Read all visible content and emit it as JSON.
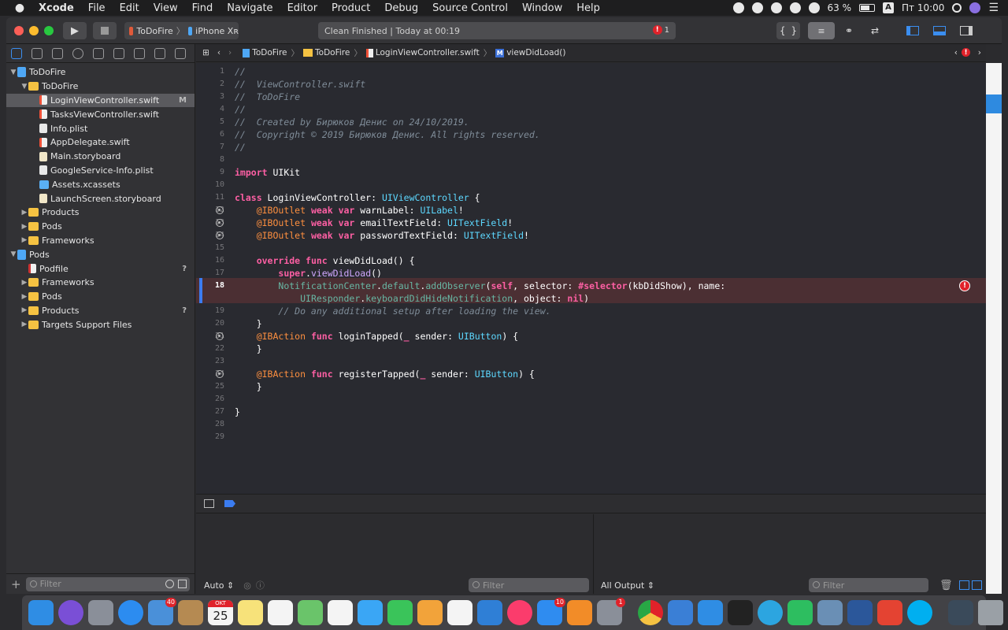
{
  "menubar": {
    "app_name": "Xcode",
    "menus": [
      "File",
      "Edit",
      "View",
      "Find",
      "Navigate",
      "Editor",
      "Product",
      "Debug",
      "Source Control",
      "Window",
      "Help"
    ],
    "battery": "63 %",
    "input_source": "A",
    "clock": "Пт 10:00"
  },
  "toolbar": {
    "scheme_name": "ToDoFire",
    "device_name": "iPhone Xʀ",
    "status_text": "Clean Finished | Today at 00:19",
    "error_count": "1"
  },
  "navigator": {
    "items": [
      {
        "label": "ToDoFire",
        "indent": 0,
        "icon": "project",
        "disclosure": "open"
      },
      {
        "label": "ToDoFire",
        "indent": 1,
        "icon": "folder",
        "disclosure": "open"
      },
      {
        "label": "LoginViewController.swift",
        "indent": 2,
        "icon": "swift",
        "selected": true,
        "badge": "M"
      },
      {
        "label": "TasksViewController.swift",
        "indent": 2,
        "icon": "swift"
      },
      {
        "label": "Info.plist",
        "indent": 2,
        "icon": "plist"
      },
      {
        "label": "AppDelegate.swift",
        "indent": 2,
        "icon": "swift"
      },
      {
        "label": "Main.storyboard",
        "indent": 2,
        "icon": "storyboard"
      },
      {
        "label": "GoogleService-Info.plist",
        "indent": 2,
        "icon": "plist"
      },
      {
        "label": "Assets.xcassets",
        "indent": 2,
        "icon": "assets"
      },
      {
        "label": "LaunchScreen.storyboard",
        "indent": 2,
        "icon": "storyboard"
      },
      {
        "label": "Products",
        "indent": 1,
        "icon": "folder",
        "disclosure": "closed"
      },
      {
        "label": "Pods",
        "indent": 1,
        "icon": "folder",
        "disclosure": "closed"
      },
      {
        "label": "Frameworks",
        "indent": 1,
        "icon": "folder",
        "disclosure": "closed"
      },
      {
        "label": "Pods",
        "indent": 0,
        "icon": "project",
        "disclosure": "open"
      },
      {
        "label": "Podfile",
        "indent": 1,
        "icon": "podfile",
        "badge": "?"
      },
      {
        "label": "Frameworks",
        "indent": 1,
        "icon": "folder",
        "disclosure": "closed"
      },
      {
        "label": "Pods",
        "indent": 1,
        "icon": "folder",
        "disclosure": "closed"
      },
      {
        "label": "Products",
        "indent": 1,
        "icon": "folder",
        "disclosure": "closed",
        "badge": "?"
      },
      {
        "label": "Targets Support Files",
        "indent": 1,
        "icon": "folder",
        "disclosure": "closed"
      }
    ],
    "filter_placeholder": "Filter"
  },
  "jumpbar": {
    "crumbs": [
      "ToDoFire",
      "ToDoFire",
      "LoginViewController.swift",
      "viewDidLoad()"
    ]
  },
  "editor": {
    "current_line": 18,
    "lines": [
      {
        "n": "1",
        "tokens": [
          [
            "cm",
            "//"
          ]
        ]
      },
      {
        "n": "2",
        "tokens": [
          [
            "cm",
            "//  ViewController.swift"
          ]
        ]
      },
      {
        "n": "3",
        "tokens": [
          [
            "cm",
            "//  ToDoFire"
          ]
        ]
      },
      {
        "n": "4",
        "tokens": [
          [
            "cm",
            "//"
          ]
        ]
      },
      {
        "n": "5",
        "tokens": [
          [
            "cm",
            "//  Created by Бирюков Денис on 24/10/2019."
          ]
        ]
      },
      {
        "n": "6",
        "tokens": [
          [
            "cm",
            "//  Copyright © 2019 Бирюков Денис. All rights reserved."
          ]
        ]
      },
      {
        "n": "7",
        "tokens": [
          [
            "cm",
            "//"
          ]
        ]
      },
      {
        "n": "8",
        "tokens": []
      },
      {
        "n": "9",
        "tokens": [
          [
            "kw",
            "import"
          ],
          [
            "pl",
            " UIKit"
          ]
        ]
      },
      {
        "n": "10",
        "tokens": []
      },
      {
        "n": "11",
        "tokens": [
          [
            "kw",
            "class"
          ],
          [
            "pl",
            " LoginViewController: "
          ],
          [
            "ty",
            "UIViewController"
          ],
          [
            "pl",
            " {"
          ]
        ]
      },
      {
        "n": "12",
        "bp": true,
        "tokens": [
          [
            "pl",
            "    "
          ],
          [
            "at",
            "@IBOutlet"
          ],
          [
            "pl",
            " "
          ],
          [
            "kw",
            "weak var"
          ],
          [
            "pl",
            " warnLabel: "
          ],
          [
            "ty",
            "UILabel"
          ],
          [
            "pl",
            "!"
          ]
        ]
      },
      {
        "n": "13",
        "bp": true,
        "tokens": [
          [
            "pl",
            "    "
          ],
          [
            "at",
            "@IBOutlet"
          ],
          [
            "pl",
            " "
          ],
          [
            "kw",
            "weak var"
          ],
          [
            "pl",
            " emailTextField: "
          ],
          [
            "ty",
            "UITextField"
          ],
          [
            "pl",
            "!"
          ]
        ]
      },
      {
        "n": "14",
        "bp": true,
        "tokens": [
          [
            "pl",
            "    "
          ],
          [
            "at",
            "@IBOutlet"
          ],
          [
            "pl",
            " "
          ],
          [
            "kw",
            "weak var"
          ],
          [
            "pl",
            " passwordTextField: "
          ],
          [
            "ty",
            "UITextField"
          ],
          [
            "pl",
            "!"
          ]
        ]
      },
      {
        "n": "15",
        "tokens": []
      },
      {
        "n": "16",
        "tokens": [
          [
            "pl",
            "    "
          ],
          [
            "kw",
            "override func"
          ],
          [
            "pl",
            " viewDidLoad() {"
          ]
        ]
      },
      {
        "n": "17",
        "tokens": [
          [
            "pl",
            "        "
          ],
          [
            "kw",
            "super"
          ],
          [
            "pl",
            "."
          ],
          [
            "ty2",
            "viewDidLoad"
          ],
          [
            "pl",
            "()"
          ]
        ]
      },
      {
        "n": "18",
        "tokens": [
          [
            "pl",
            "        "
          ],
          [
            "fn",
            "NotificationCenter"
          ],
          [
            "pl",
            "."
          ],
          [
            "fn",
            "default"
          ],
          [
            "pl",
            "."
          ],
          [
            "fn",
            "addObserver"
          ],
          [
            "pl",
            "("
          ],
          [
            "kw",
            "self"
          ],
          [
            "pl",
            ", selector: "
          ],
          [
            "kw",
            "#selector"
          ],
          [
            "pl",
            "(kbDidShow), name:"
          ]
        ]
      },
      {
        "n": "",
        "tokens": [
          [
            "pl",
            "            "
          ],
          [
            "fn",
            "UIResponder"
          ],
          [
            "pl",
            "."
          ],
          [
            "fn",
            "keyboardDidHideNotification"
          ],
          [
            "pl",
            ", object: "
          ],
          [
            "kw",
            "nil"
          ],
          [
            "pl",
            ")"
          ]
        ]
      },
      {
        "n": "19",
        "tokens": [
          [
            "pl",
            "        "
          ],
          [
            "cm",
            "// Do any additional setup after loading the view."
          ]
        ]
      },
      {
        "n": "20",
        "tokens": [
          [
            "pl",
            "    }"
          ]
        ]
      },
      {
        "n": "21",
        "bp": true,
        "tokens": [
          [
            "pl",
            "    "
          ],
          [
            "at",
            "@IBAction"
          ],
          [
            "pl",
            " "
          ],
          [
            "kw",
            "func"
          ],
          [
            "pl",
            " loginTapped("
          ],
          [
            "kw",
            "_"
          ],
          [
            "pl",
            " sender: "
          ],
          [
            "ty",
            "UIButton"
          ],
          [
            "pl",
            ") {"
          ]
        ]
      },
      {
        "n": "22",
        "tokens": [
          [
            "pl",
            "    }"
          ]
        ]
      },
      {
        "n": "23",
        "tokens": []
      },
      {
        "n": "24",
        "bp": true,
        "tokens": [
          [
            "pl",
            "    "
          ],
          [
            "at",
            "@IBAction"
          ],
          [
            "pl",
            " "
          ],
          [
            "kw",
            "func"
          ],
          [
            "pl",
            " registerTapped("
          ],
          [
            "kw",
            "_"
          ],
          [
            "pl",
            " sender: "
          ],
          [
            "ty",
            "UIButton"
          ],
          [
            "pl",
            ") {"
          ]
        ]
      },
      {
        "n": "25",
        "tokens": [
          [
            "pl",
            "    }"
          ]
        ]
      },
      {
        "n": "26",
        "tokens": []
      },
      {
        "n": "27",
        "tokens": [
          [
            "pl",
            "}"
          ]
        ]
      },
      {
        "n": "28",
        "tokens": []
      },
      {
        "n": "29",
        "tokens": []
      }
    ],
    "error_marker": "!"
  },
  "debug": {
    "variables_mode": "Auto",
    "variables_filter_placeholder": "Filter",
    "output_mode": "All Output",
    "output_filter_placeholder": "Filter"
  },
  "dock": {
    "calendar_month": "OKT",
    "calendar_day": "25",
    "apps": [
      {
        "name": "finder",
        "color": "#2f8de4"
      },
      {
        "name": "siri",
        "color": "#7a4fd6"
      },
      {
        "name": "launchpad",
        "color": "#8a8f99"
      },
      {
        "name": "safari",
        "color": "#2c8cf0"
      },
      {
        "name": "mail",
        "color": "#4a90d9",
        "badge": "40"
      },
      {
        "name": "contacts",
        "color": "#b58a52"
      },
      {
        "name": "calendar",
        "color": "#f4f4f4"
      },
      {
        "name": "notes",
        "color": "#f7e27a"
      },
      {
        "name": "reminders",
        "color": "#f4f4f4"
      },
      {
        "name": "maps",
        "color": "#6ac46a"
      },
      {
        "name": "photos",
        "color": "#f4f4f4"
      },
      {
        "name": "messages",
        "color": "#3aa6f5"
      },
      {
        "name": "facetime",
        "color": "#3ac45a"
      },
      {
        "name": "pages",
        "color": "#f2a33a"
      },
      {
        "name": "numbers",
        "color": "#f4f4f4"
      },
      {
        "name": "keynote",
        "color": "#2f7fd6"
      },
      {
        "name": "music",
        "color": "#fb3c6c"
      },
      {
        "name": "app-store",
        "color": "#2f8cf0",
        "badge": "10"
      },
      {
        "name": "books",
        "color": "#f28c28"
      },
      {
        "name": "system-preferences",
        "color": "#8a8f99",
        "badge": "1"
      },
      {
        "name": "chrome",
        "color": "#f4f4f4"
      },
      {
        "name": "xcode-alt",
        "color": "#3a7fd6"
      },
      {
        "name": "xcode",
        "color": "#2f8de4"
      },
      {
        "name": "terminal",
        "color": "#222222"
      },
      {
        "name": "telegram",
        "color": "#2ca5e0"
      },
      {
        "name": "evernote",
        "color": "#2dbe60"
      },
      {
        "name": "preview",
        "color": "#6a8fb5"
      },
      {
        "name": "word",
        "color": "#2b579a"
      },
      {
        "name": "todoist",
        "color": "#e44332"
      },
      {
        "name": "skype",
        "color": "#00aff0"
      }
    ]
  }
}
